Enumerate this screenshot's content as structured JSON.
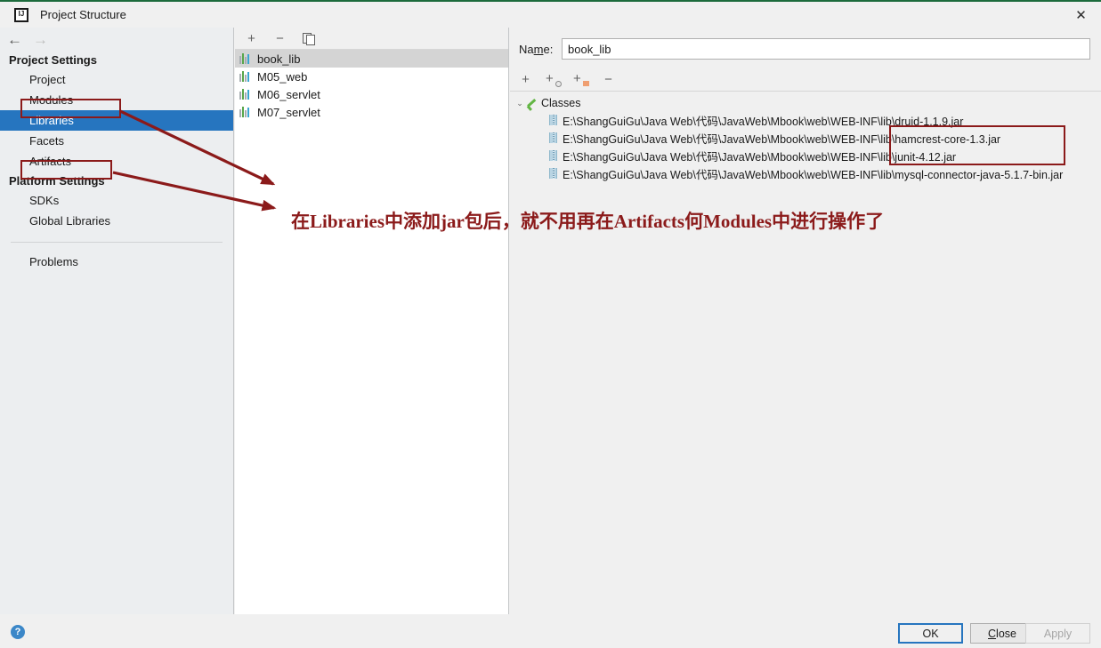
{
  "window": {
    "title": "Project Structure",
    "app_icon": "intellij-idea-icon",
    "close_label": "✕"
  },
  "nav": {
    "back_icon": "←",
    "forward_icon": "→"
  },
  "sidebar": {
    "groups": [
      {
        "title": "Project Settings",
        "items": [
          {
            "label": "Project",
            "selected": false
          },
          {
            "label": "Modules",
            "selected": false
          },
          {
            "label": "Libraries",
            "selected": true
          },
          {
            "label": "Facets",
            "selected": false
          },
          {
            "label": "Artifacts",
            "selected": false
          }
        ]
      },
      {
        "title": "Platform Settings",
        "items": [
          {
            "label": "SDKs",
            "selected": false
          },
          {
            "label": "Global Libraries",
            "selected": false
          }
        ]
      }
    ],
    "problems_label": "Problems"
  },
  "list_panel": {
    "toolbar": [
      {
        "name": "add-library-button",
        "glyph": "+"
      },
      {
        "name": "remove-library-button",
        "glyph": "−"
      },
      {
        "name": "copy-library-button",
        "glyph": ""
      }
    ],
    "libraries": [
      {
        "name": "book_lib",
        "selected": true
      },
      {
        "name": "M05_web",
        "selected": false
      },
      {
        "name": "M06_servlet",
        "selected": false
      },
      {
        "name": "M07_servlet",
        "selected": false
      }
    ]
  },
  "detail_panel": {
    "name_label_pre": "Na",
    "name_label_mnemonic": "m",
    "name_label_post": "e:",
    "name_value": "book_lib",
    "name_placeholder": "",
    "toolbar": [
      {
        "name": "add-root-button",
        "glyph": "+"
      },
      {
        "name": "add-classes-root-button",
        "glyph": "+"
      },
      {
        "name": "add-sources-root-button",
        "glyph": "+"
      },
      {
        "name": "remove-root-button",
        "glyph": "−"
      }
    ],
    "tree": {
      "expand_icon": "⌄",
      "root_label": "Classes",
      "jars": [
        "E:\\ShangGuiGu\\Java Web\\代码\\JavaWeb\\Mbook\\web\\WEB-INF\\lib\\druid-1.1.9.jar",
        "E:\\ShangGuiGu\\Java Web\\代码\\JavaWeb\\Mbook\\web\\WEB-INF\\lib\\hamcrest-core-1.3.jar",
        "E:\\ShangGuiGu\\Java Web\\代码\\JavaWeb\\Mbook\\web\\WEB-INF\\lib\\junit-4.12.jar",
        "E:\\ShangGuiGu\\Java Web\\代码\\JavaWeb\\Mbook\\web\\WEB-INF\\lib\\mysql-connector-java-5.1.7-bin.jar"
      ]
    }
  },
  "bottom": {
    "help_glyph": "?",
    "ok_label": "OK",
    "close_pre": "",
    "close_mnemonic": "C",
    "close_post": "lose",
    "apply_label": "Apply"
  },
  "annotation": {
    "color": "#8b1a1a",
    "text": "在Libraries中添加jar包后，就不用再在Artifacts何Modules中进行操作了",
    "boxes": [
      {
        "name": "modules-highlight-box"
      },
      {
        "name": "artifacts-highlight-box"
      },
      {
        "name": "jar-paths-highlight-box"
      }
    ]
  }
}
